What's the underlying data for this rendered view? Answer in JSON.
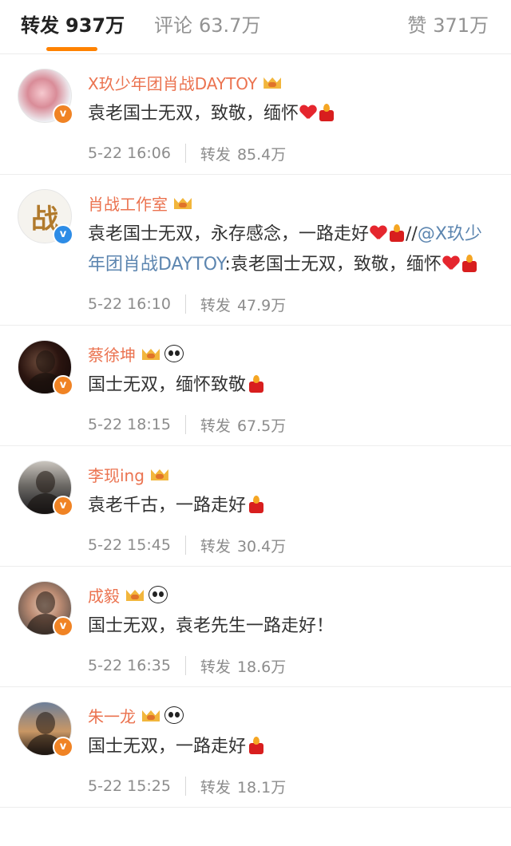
{
  "tabs": {
    "repost": {
      "label": "转发",
      "count": "937万"
    },
    "comments": {
      "label": "评论",
      "count": "63.7万"
    },
    "likes": {
      "label": "赞",
      "count": "371万"
    }
  },
  "colors": {
    "accent": "#ff8200",
    "username": "#eb7350",
    "mention": "#5d86b0",
    "muted": "#8c8c8c"
  },
  "reposts": [
    {
      "user": "X玖少年团肖战DAYTOY",
      "badges": [
        "crown-icon"
      ],
      "verify": "orange",
      "text": "袁老国士无双，致敬，缅怀",
      "mention": "",
      "text2": "",
      "emoji": [
        "heart-emoji",
        "candle-emoji"
      ],
      "emoji2": [],
      "time": "5-22 16:06",
      "repost_label": "转发",
      "repost_count": "85.4万"
    },
    {
      "user": "肖战工作室",
      "badges": [
        "crown-icon"
      ],
      "verify": "blue",
      "avatar_glyph": "战",
      "text": "袁老国士无双，永存感念，一路走好",
      "emoji": [
        "heart-emoji",
        "candle-emoji"
      ],
      "after_emoji": "//",
      "mention": "@X玖少年团肖战DAYTOY",
      "text2": ":袁老国士无双，致敬，缅怀",
      "emoji2": [
        "heart-emoji",
        "candle-emoji"
      ],
      "time": "5-22 16:10",
      "repost_label": "转发",
      "repost_count": "47.9万"
    },
    {
      "user": "蔡徐坤",
      "badges": [
        "crown-icon",
        "panda-icon"
      ],
      "verify": "orange",
      "text": "国士无双，缅怀致敬",
      "mention": "",
      "text2": "",
      "emoji": [
        "candle-emoji"
      ],
      "emoji2": [],
      "time": "5-22 18:15",
      "repost_label": "转发",
      "repost_count": "67.5万"
    },
    {
      "user": "李现ing",
      "badges": [
        "crown-icon"
      ],
      "verify": "orange",
      "text": "袁老千古，一路走好",
      "mention": "",
      "text2": "",
      "emoji": [
        "candle-emoji"
      ],
      "emoji2": [],
      "time": "5-22 15:45",
      "repost_label": "转发",
      "repost_count": "30.4万"
    },
    {
      "user": "成毅",
      "badges": [
        "crown-icon",
        "panda-icon"
      ],
      "verify": "orange",
      "text": "国士无双，袁老先生一路走好！",
      "mention": "",
      "text2": "",
      "emoji": [],
      "emoji2": [],
      "time": "5-22 16:35",
      "repost_label": "转发",
      "repost_count": "18.6万"
    },
    {
      "user": "朱一龙",
      "badges": [
        "crown-icon",
        "panda-icon"
      ],
      "verify": "orange",
      "text": "国士无双，一路走好",
      "mention": "",
      "text2": "",
      "emoji": [
        "candle-emoji"
      ],
      "emoji2": [],
      "time": "5-22 15:25",
      "repost_label": "转发",
      "repost_count": "18.1万"
    }
  ]
}
